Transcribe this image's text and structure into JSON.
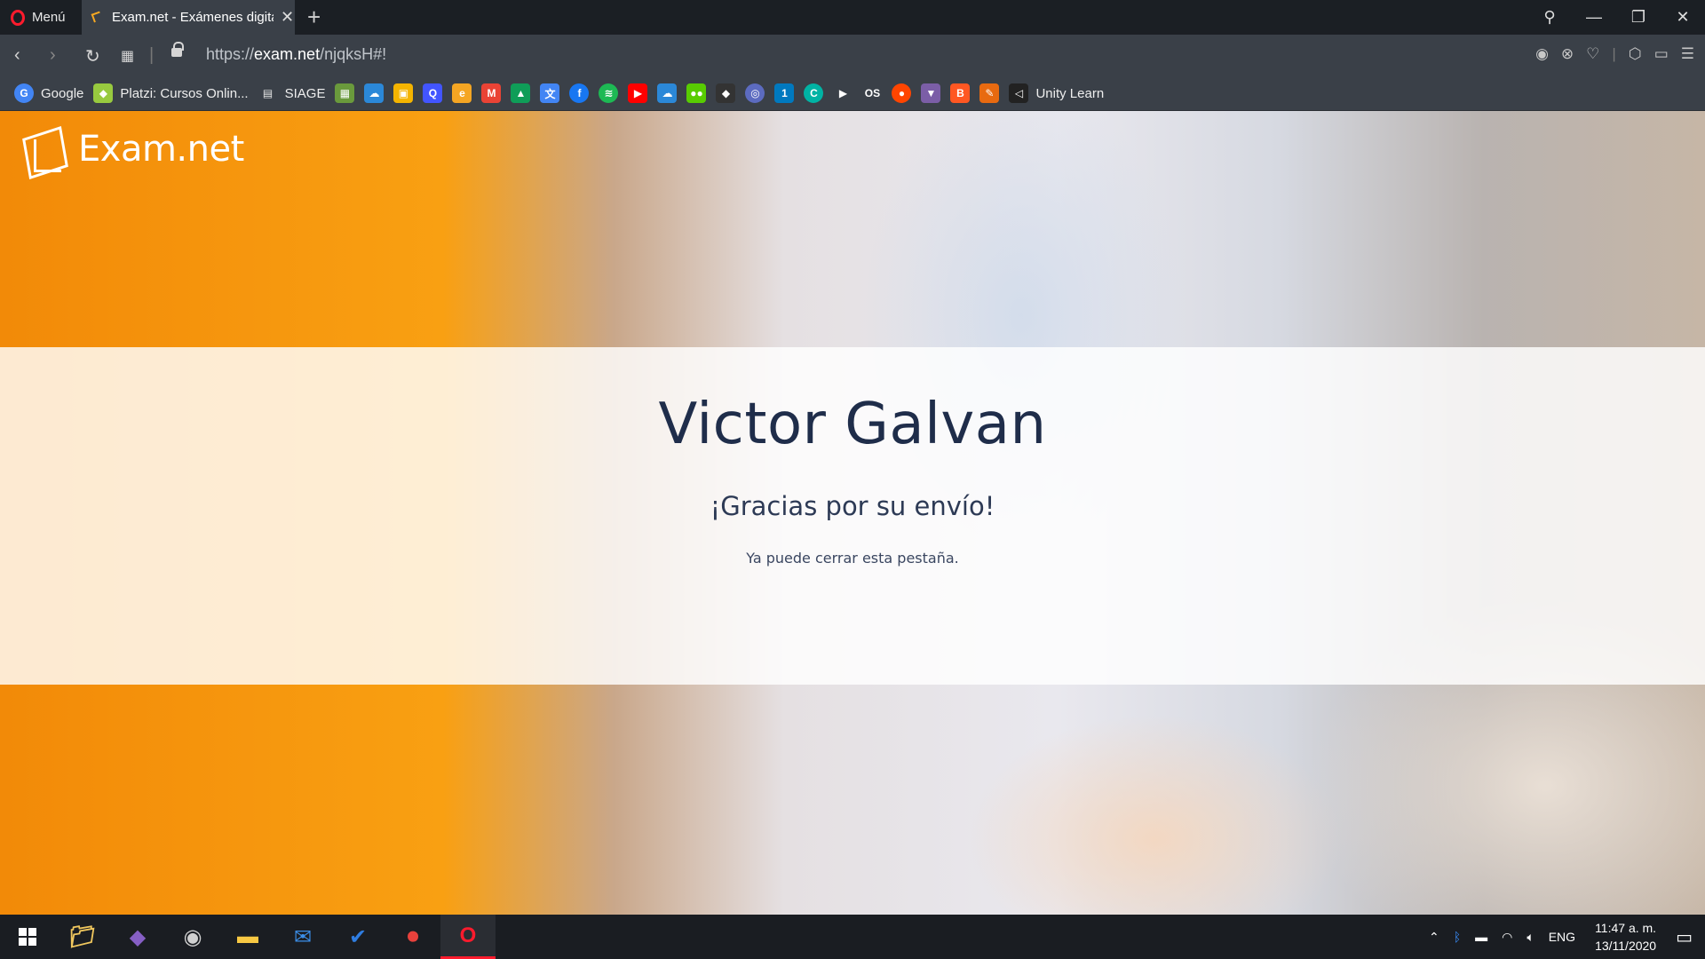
{
  "browser": {
    "menu_label": "Menú",
    "tab_title": "Exam.net - Exámenes digita",
    "url_prefix": "https://",
    "url_host": "exam.net",
    "url_path": "/njqksH#!",
    "bookmarks": [
      {
        "label": "Google",
        "icon": "google-icon",
        "color": "#4285f4",
        "glyph": "G"
      },
      {
        "label": "Platzi: Cursos Onlin...",
        "icon": "platzi-icon",
        "color": "#98ca3f",
        "glyph": "◆"
      },
      {
        "label": "SIAGE",
        "icon": "document-icon",
        "color": "#e6e6e6",
        "glyph": "▤"
      }
    ],
    "bookmark_icons": [
      {
        "icon": "minecraft-icon",
        "color": "#6a9a3c",
        "glyph": "▦"
      },
      {
        "icon": "onedrive-icon",
        "color": "#2b88d8",
        "glyph": "☁"
      },
      {
        "icon": "classroom-icon",
        "color": "#f4b400",
        "glyph": "▣"
      },
      {
        "icon": "quizlet-icon",
        "color": "#4255ff",
        "glyph": "Q"
      },
      {
        "icon": "edpuzzle-icon",
        "color": "#f5a623",
        "glyph": "e"
      },
      {
        "icon": "gmail-icon",
        "color": "#ea4335",
        "glyph": "M"
      },
      {
        "icon": "drive-icon",
        "color": "#0f9d58",
        "glyph": "▲"
      },
      {
        "icon": "translate-icon",
        "color": "#4285f4",
        "glyph": "文"
      },
      {
        "icon": "facebook-icon",
        "color": "#1877f2",
        "glyph": "f"
      },
      {
        "icon": "spotify-icon",
        "color": "#1db954",
        "glyph": "≋"
      },
      {
        "icon": "youtube-icon",
        "color": "#ff0000",
        "glyph": "▶"
      },
      {
        "icon": "onedrive-2-icon",
        "color": "#2b88d8",
        "glyph": "☁"
      },
      {
        "icon": "duolingo-icon",
        "color": "#58cc02",
        "glyph": "●●"
      },
      {
        "icon": "unity-icon",
        "color": "#333333",
        "glyph": "◆"
      },
      {
        "icon": "circle-icon",
        "color": "#5c6bc0",
        "glyph": "◎"
      },
      {
        "icon": "trello-icon",
        "color": "#0079bf",
        "glyph": "1"
      },
      {
        "icon": "c-icon",
        "color": "#00b3a4",
        "glyph": "C"
      },
      {
        "icon": "play-icon",
        "color": "#ffffff",
        "glyph": "▶"
      },
      {
        "icon": "os-icon",
        "color": "#ffffff",
        "glyph": "OS"
      },
      {
        "icon": "reddit-icon",
        "color": "#ff4500",
        "glyph": "●"
      },
      {
        "icon": "ufo-icon",
        "color": "#7b5ea7",
        "glyph": "▼"
      },
      {
        "icon": "blogger-icon",
        "color": "#ff5722",
        "glyph": "B"
      },
      {
        "icon": "pen-icon",
        "color": "#e86a10",
        "glyph": "✎"
      }
    ],
    "last_bookmark": {
      "label": "Unity Learn",
      "icon": "unity-learn-icon"
    }
  },
  "page": {
    "logo_text": "Exam.net",
    "student_name": "Victor Galvan",
    "thanks": "¡Gracias por su envío!",
    "close_message": "Ya puede cerrar esta pestaña."
  },
  "taskbar": {
    "language": "ENG",
    "time": "11:47 a. m.",
    "date": "13/11/2020",
    "apps": [
      {
        "name": "file-explorer-folder-icon",
        "color": "#f0c75e"
      },
      {
        "name": "visual-studio-icon",
        "color": "#865fc5"
      },
      {
        "name": "disc-app-icon",
        "color": "#d0d0d0"
      },
      {
        "name": "file-explorer-icon",
        "color": "#f8c843"
      },
      {
        "name": "mail-icon",
        "color": "#3b8ee8"
      },
      {
        "name": "todo-icon",
        "color": "#2f7de1"
      },
      {
        "name": "recorder-icon",
        "color": "#e8413c"
      },
      {
        "name": "opera-icon",
        "color": "#ff1b2d"
      }
    ]
  },
  "colors": {
    "accent_orange": "#f9a012",
    "title_navy": "#1f2d4a",
    "opera_red": "#ff1b2d"
  }
}
